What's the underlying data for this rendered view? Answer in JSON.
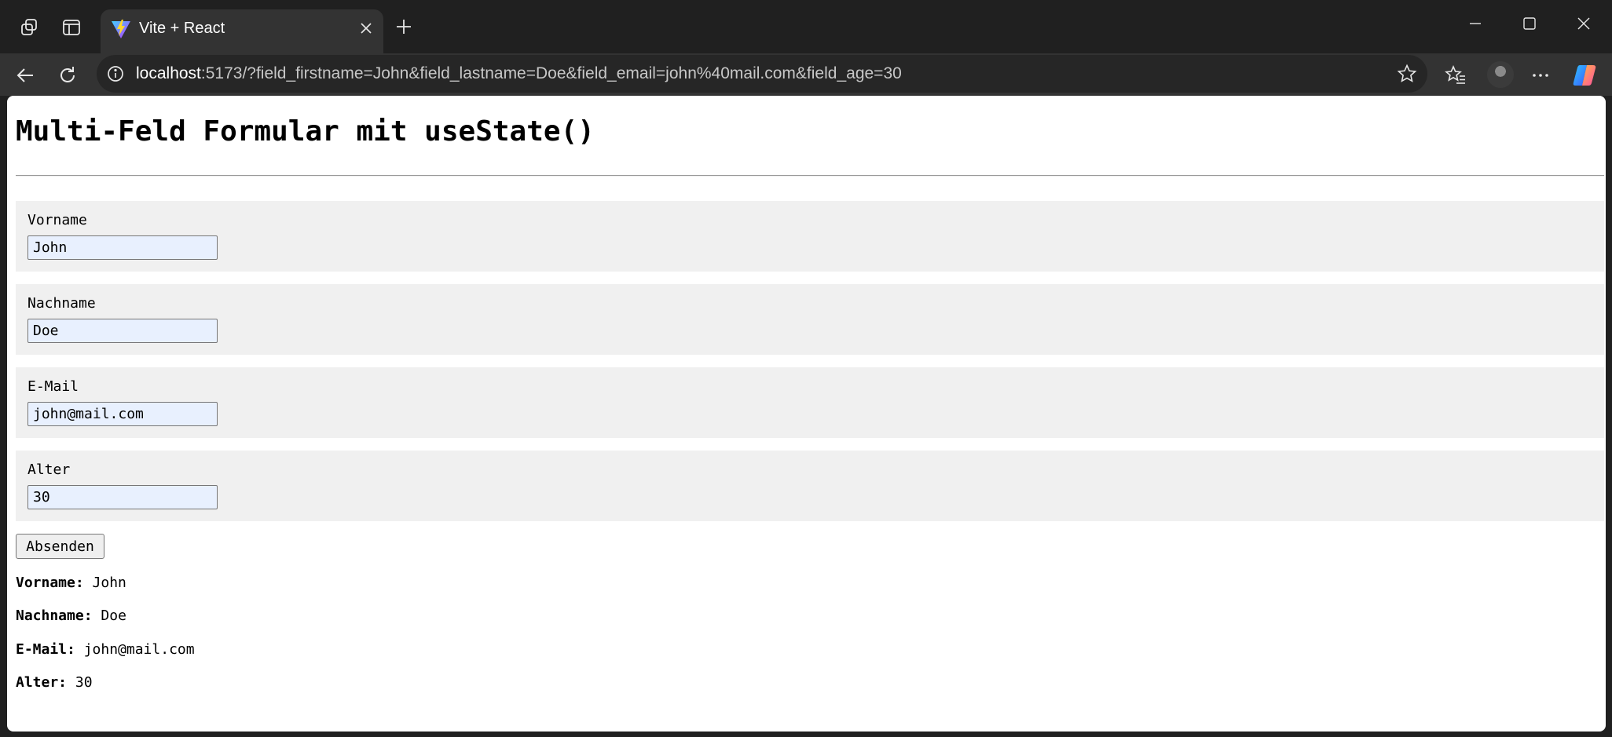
{
  "browser": {
    "tab_title": "Vite + React",
    "url_host": "localhost",
    "url_rest": ":5173/?field_firstname=John&field_lastname=Doe&field_email=john%40mail.com&field_age=30"
  },
  "page": {
    "title": "Multi-Feld Formular mit useState()",
    "fields": [
      {
        "label": "Vorname",
        "value": "John"
      },
      {
        "label": "Nachname",
        "value": "Doe"
      },
      {
        "label": "E-Mail",
        "value": "john@mail.com"
      },
      {
        "label": "Alter",
        "value": "30"
      }
    ],
    "submit_label": "Absenden",
    "results": [
      {
        "label": "Vorname:",
        "value": "John"
      },
      {
        "label": "Nachname:",
        "value": "Doe"
      },
      {
        "label": "E-Mail:",
        "value": "john@mail.com"
      },
      {
        "label": "Alter:",
        "value": "30"
      }
    ]
  },
  "colors": {
    "chrome_dark": "#202020",
    "toolbar": "#333333",
    "field_group_bg": "#f0f0f0",
    "autofill_bg": "#e8f0fe"
  },
  "icons": [
    "workspaces-icon",
    "vertical-tabs-icon",
    "vite-favicon-icon",
    "close-tab-icon",
    "new-tab-icon",
    "minimize-icon",
    "maximize-icon",
    "close-window-icon",
    "back-icon",
    "refresh-icon",
    "info-icon",
    "favorite-star-icon",
    "favorites-icon",
    "profile-avatar",
    "more-icon",
    "copilot-icon"
  ]
}
